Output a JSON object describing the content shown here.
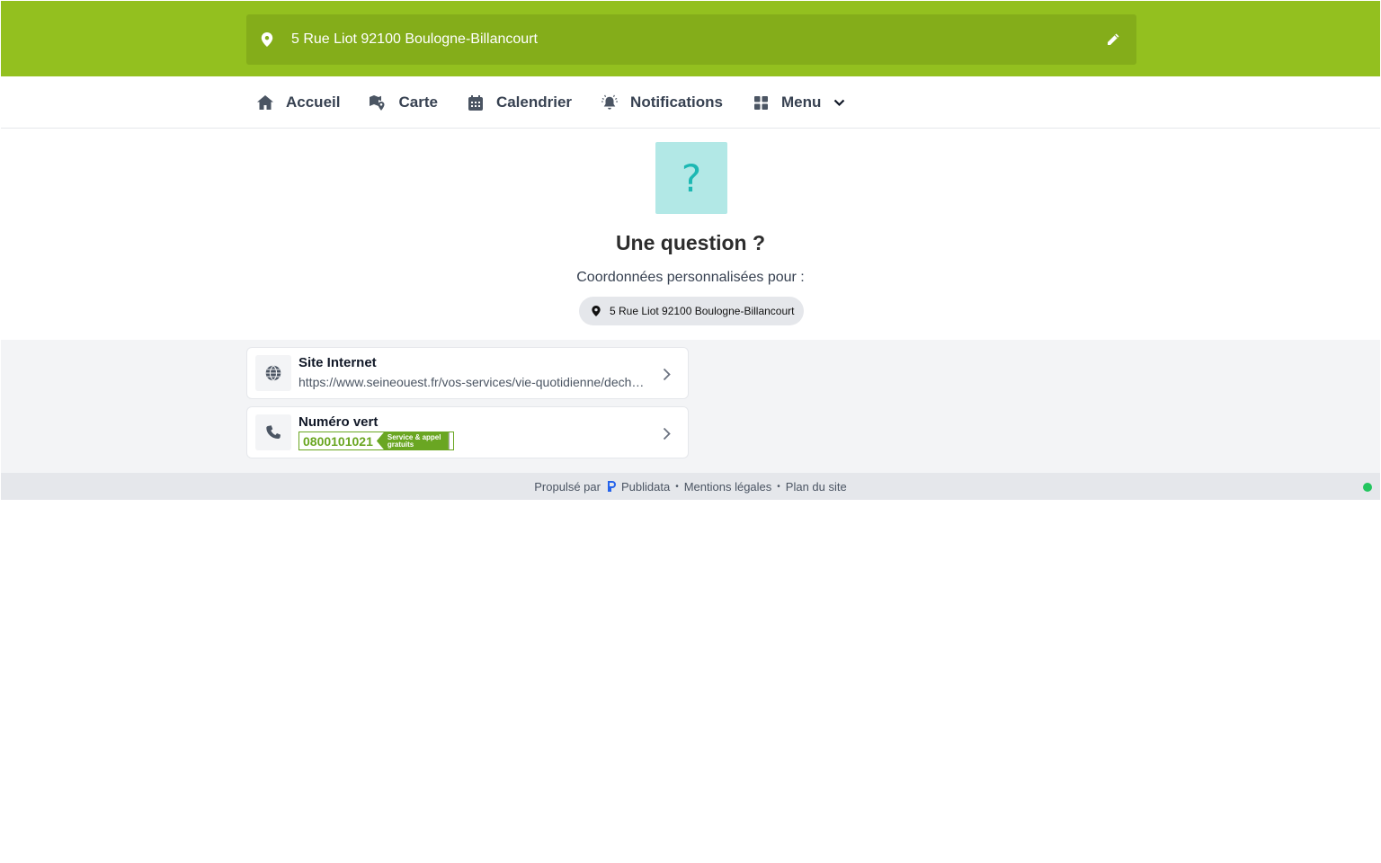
{
  "header": {
    "address": "5 Rue Liot 92100 Boulogne-Billancourt",
    "pin_icon": "map-pin-icon",
    "edit_icon": "pencil-icon"
  },
  "nav": {
    "items": [
      {
        "label": "Accueil",
        "icon": "home-icon"
      },
      {
        "label": "Carte",
        "icon": "map-icon"
      },
      {
        "label": "Calendrier",
        "icon": "calendar-icon"
      },
      {
        "label": "Notifications",
        "icon": "bell-icon"
      },
      {
        "label": "Menu",
        "icon": "grid-icon"
      }
    ]
  },
  "hero": {
    "glyph": "?",
    "title": "Une question ?",
    "subtitle": "Coordonnées personnalisées pour :",
    "address_chip": "5 Rue Liot 92100 Boulogne-Billancourt"
  },
  "contacts": [
    {
      "title": "Site Internet",
      "value": "https://www.seineouest.fr/vos-services/vie-quotidienne/dechets-proprete",
      "icon": "globe-icon"
    },
    {
      "title": "Numéro vert",
      "number": "0800101021",
      "tag": "Service & appel gratuits",
      "icon": "phone-icon"
    }
  ],
  "footer": {
    "powered_by": "Propulsé par",
    "brand": "Publidata",
    "legal": "Mentions légales",
    "sitemap": "Plan du site",
    "separator": "•"
  },
  "colors": {
    "brand_green": "#93c01f",
    "address_bar": "#84ad1a",
    "teal": "#1cb8b3",
    "numvert_green": "#6aa622",
    "status": "#22c55e"
  }
}
